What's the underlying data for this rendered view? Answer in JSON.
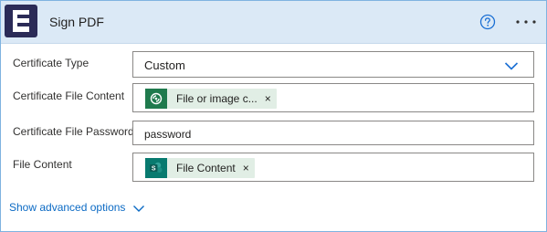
{
  "header": {
    "title": "Sign PDF",
    "help_icon": "help-circle-icon",
    "more_icon": "more-horizontal-icon",
    "accent": "#1a6fd4",
    "logo_color": "#2b2b57"
  },
  "fields": {
    "certificate_type": {
      "label": "Certificate Type",
      "value": "Custom"
    },
    "certificate_file_content": {
      "label": "Certificate File Content",
      "token": "File or image c...",
      "token_remove": "×",
      "token_icon": "dataverse-icon",
      "token_icon_color": "#1f7a4d"
    },
    "certificate_file_password": {
      "label": "Certificate File Password",
      "value": "password"
    },
    "file_content": {
      "label": "File Content",
      "token": "File Content",
      "token_remove": "×",
      "token_icon": "sharepoint-icon",
      "token_icon_color": "#087a6f"
    }
  },
  "advanced": {
    "label": "Show advanced options"
  }
}
